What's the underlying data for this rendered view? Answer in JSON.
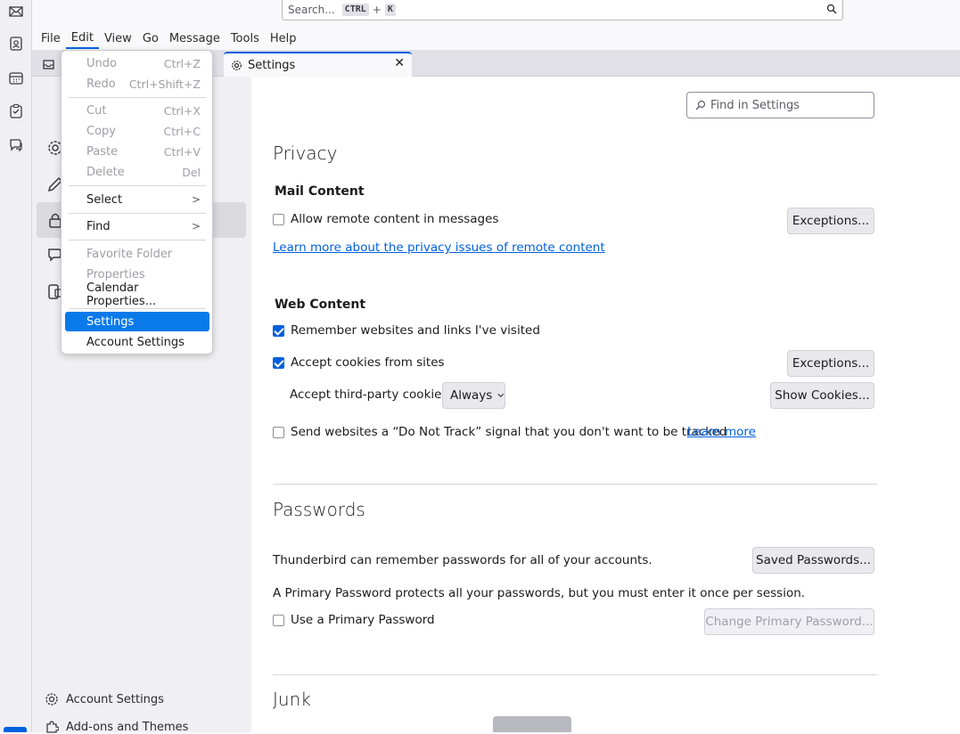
{
  "search": {
    "placeholder": "Search...",
    "key1": "CTRL",
    "plus": "+",
    "key2": "K"
  },
  "menubar": [
    "File",
    "Edit",
    "View",
    "Go",
    "Message",
    "Tools",
    "Help"
  ],
  "tabs": {
    "settings_tab": "Settings"
  },
  "nav": {
    "account_settings": "Account Settings",
    "addons": "Add-ons and Themes"
  },
  "find": {
    "placeholder": "Find in Settings"
  },
  "privacy": {
    "title": "Privacy",
    "mail_content": "Mail Content",
    "allow_remote": "Allow remote content in messages",
    "exceptions": "Exceptions...",
    "learn_more_remote": "Learn more about the privacy issues of remote content",
    "web_content": "Web Content",
    "remember_sites": "Remember websites and links I've visited",
    "accept_cookies": "Accept cookies from sites",
    "exceptions2": "Exceptions...",
    "third_party": "Accept third-party cookies:",
    "third_party_value": "Always",
    "show_cookies": "Show Cookies...",
    "dnt": "Send websites a “Do Not Track” signal that you don't want to be tracked",
    "learn_more": "Learn more"
  },
  "passwords": {
    "title": "Passwords",
    "remember_text": "Thunderbird can remember passwords for all of your accounts.",
    "saved_passwords": "Saved Passwords...",
    "primary_text": "A Primary Password protects all your passwords, but you must enter it once per session.",
    "use_primary": "Use a Primary Password",
    "change_primary": "Change Primary Password..."
  },
  "junk": {
    "title": "Junk"
  },
  "edit_menu": {
    "undo": "Undo",
    "undo_sc": "Ctrl+Z",
    "redo": "Redo",
    "redo_sc": "Ctrl+Shift+Z",
    "cut": "Cut",
    "cut_sc": "Ctrl+X",
    "copy": "Copy",
    "copy_sc": "Ctrl+C",
    "paste": "Paste",
    "paste_sc": "Ctrl+V",
    "delete": "Delete",
    "delete_sc": "Del",
    "select": "Select",
    "find": "Find",
    "favorite_folder": "Favorite Folder",
    "properties": "Properties",
    "calendar_properties": "Calendar Properties...",
    "settings": "Settings",
    "account_settings": "Account Settings"
  },
  "colors": {
    "accent": "#0060df",
    "highlight": "#0a7aea"
  }
}
